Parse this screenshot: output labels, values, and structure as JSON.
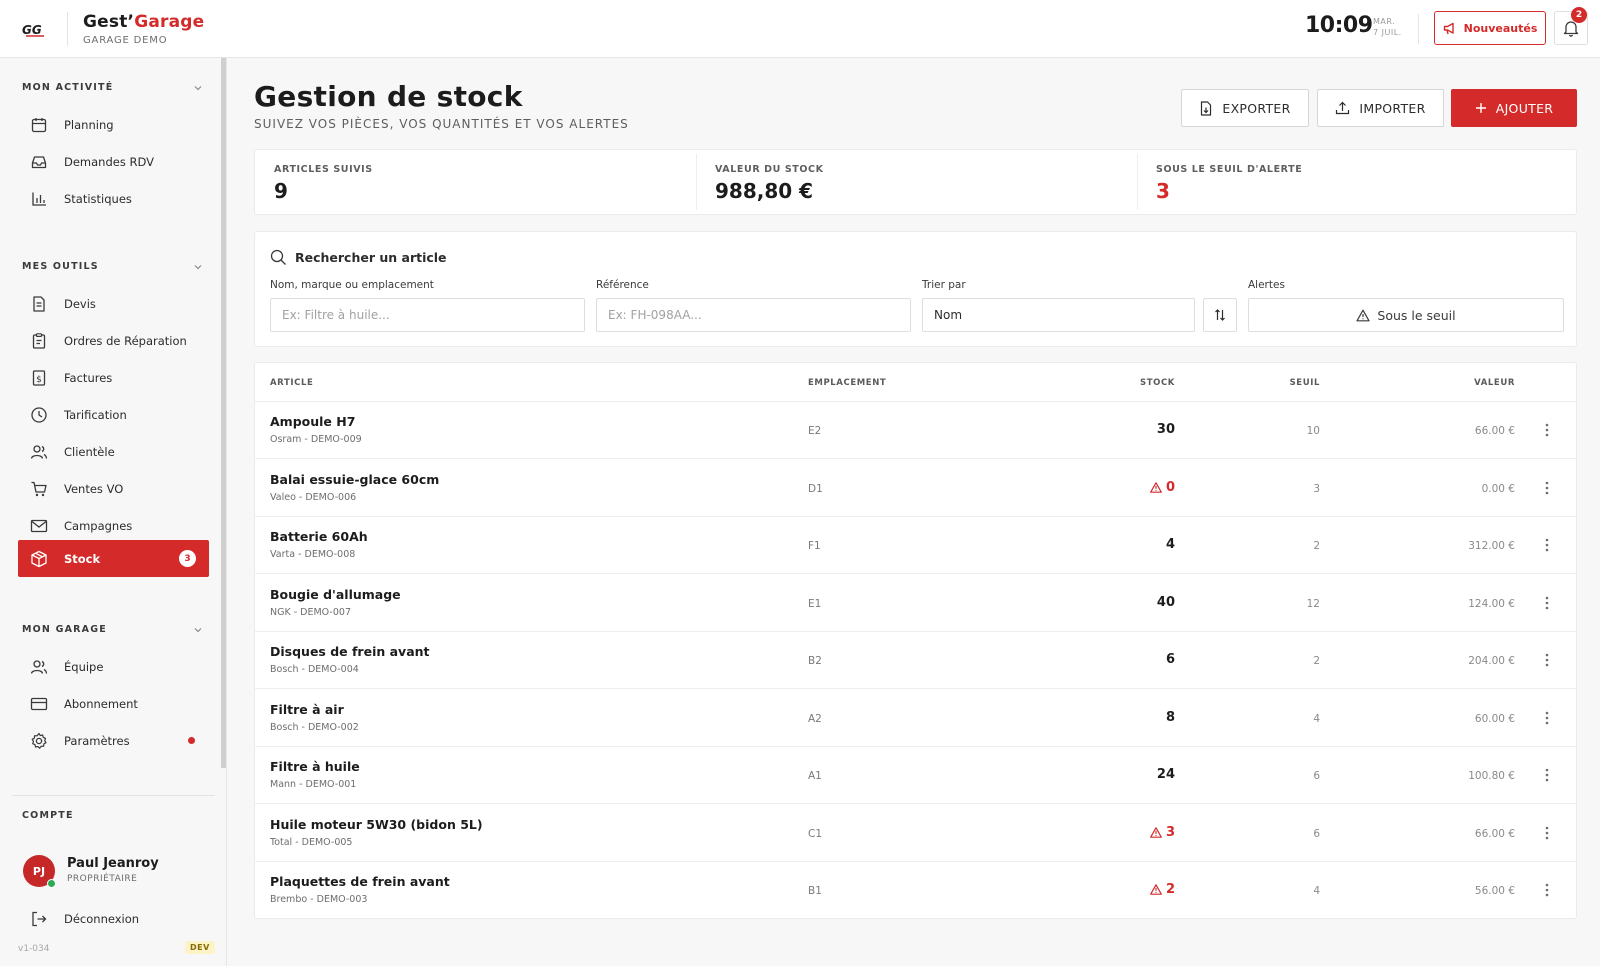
{
  "header": {
    "logo_text": "GG",
    "app_name_1": "Gest’",
    "app_name_2": "Garage",
    "garage_name": "GARAGE DEMO",
    "time": "10:09",
    "date_line1": "MAR.",
    "date_line2": "7 JUIL.",
    "news_label": "Nouveautés",
    "notifications_count": "2"
  },
  "sidebar": {
    "sections": {
      "activite": "MON ACTIVITÉ",
      "outils": "MES OUTILS",
      "garage": "MON GARAGE",
      "compte": "COMPTE"
    },
    "activite_items": [
      {
        "label": "Planning",
        "icon": "calendar-icon"
      },
      {
        "label": "Demandes RDV",
        "icon": "inbox-icon"
      },
      {
        "label": "Statistiques",
        "icon": "bar-chart-icon"
      }
    ],
    "outils_items": [
      {
        "label": "Devis",
        "icon": "document-icon"
      },
      {
        "label": "Ordres de Réparation",
        "icon": "clipboard-icon"
      },
      {
        "label": "Factures",
        "icon": "invoice-icon"
      },
      {
        "label": "Tarification",
        "icon": "clock-icon"
      },
      {
        "label": "Clientèle",
        "icon": "users-icon"
      },
      {
        "label": "Ventes VO",
        "icon": "cart-icon"
      },
      {
        "label": "Campagnes",
        "icon": "mail-icon"
      },
      {
        "label": "Stock",
        "icon": "box-icon",
        "badge": "3"
      }
    ],
    "garage_items": [
      {
        "label": "Équipe",
        "icon": "team-icon"
      },
      {
        "label": "Abonnement",
        "icon": "credit-card-icon"
      },
      {
        "label": "Paramètres",
        "icon": "gear-icon"
      }
    ],
    "user": {
      "initials": "PJ",
      "name": "Paul Jeanroy",
      "role": "PROPRIÉTAIRE"
    },
    "logout_label": "Déconnexion",
    "version": "v1-034",
    "env_badge": "DEV"
  },
  "page": {
    "title": "Gestion de stock",
    "subtitle": "SUIVEZ VOS PIÈCES, VOS QUANTITÉS ET VOS ALERTES",
    "export_label": "EXPORTER",
    "import_label": "IMPORTER",
    "add_label": "AJOUTER"
  },
  "kpis": [
    {
      "label": "ARTICLES SUIVIS",
      "value": "9"
    },
    {
      "label": "VALEUR DU STOCK",
      "value": "988,80 €"
    },
    {
      "label": "SOUS LE SEUIL D'ALERTE",
      "value": "3"
    }
  ],
  "filters": {
    "title": "Rechercher un article",
    "name_label": "Nom, marque ou emplacement",
    "name_placeholder": "Ex: Filtre à huile...",
    "ref_label": "Référence",
    "ref_placeholder": "Ex: FH-098AA...",
    "sort_label": "Trier par",
    "sort_value": "Nom",
    "alert_label": "Alertes",
    "alert_button": "Sous le seuil"
  },
  "table": {
    "headers": {
      "article": "ARTICLE",
      "location": "EMPLACEMENT",
      "stock": "STOCK",
      "threshold": "SEUIL",
      "value": "VALEUR"
    },
    "rows": [
      {
        "name": "Ampoule H7",
        "sub": "Osram - DEMO-009",
        "location": "E2",
        "stock": "30",
        "warn": false,
        "threshold": "10",
        "value": "66.00 €"
      },
      {
        "name": "Balai essuie-glace 60cm",
        "sub": "Valeo - DEMO-006",
        "location": "D1",
        "stock": "0",
        "warn": true,
        "threshold": "3",
        "value": "0.00 €"
      },
      {
        "name": "Batterie 60Ah",
        "sub": "Varta - DEMO-008",
        "location": "F1",
        "stock": "4",
        "warn": false,
        "threshold": "2",
        "value": "312.00 €"
      },
      {
        "name": "Bougie d'allumage",
        "sub": "NGK - DEMO-007",
        "location": "E1",
        "stock": "40",
        "warn": false,
        "threshold": "12",
        "value": "124.00 €"
      },
      {
        "name": "Disques de frein avant",
        "sub": "Bosch - DEMO-004",
        "location": "B2",
        "stock": "6",
        "warn": false,
        "threshold": "2",
        "value": "204.00 €"
      },
      {
        "name": "Filtre à air",
        "sub": "Bosch - DEMO-002",
        "location": "A2",
        "stock": "8",
        "warn": false,
        "threshold": "4",
        "value": "60.00 €"
      },
      {
        "name": "Filtre à huile",
        "sub": "Mann - DEMO-001",
        "location": "A1",
        "stock": "24",
        "warn": false,
        "threshold": "6",
        "value": "100.80 €"
      },
      {
        "name": "Huile moteur 5W30 (bidon 5L)",
        "sub": "Total - DEMO-005",
        "location": "C1",
        "stock": "3",
        "warn": true,
        "threshold": "6",
        "value": "66.00 €"
      },
      {
        "name": "Plaquettes de frein avant",
        "sub": "Brembo - DEMO-003",
        "location": "B1",
        "stock": "2",
        "warn": true,
        "threshold": "4",
        "value": "56.00 €"
      }
    ]
  },
  "colors": {
    "accent": "#d42a2a",
    "online": "#2eaa57"
  }
}
